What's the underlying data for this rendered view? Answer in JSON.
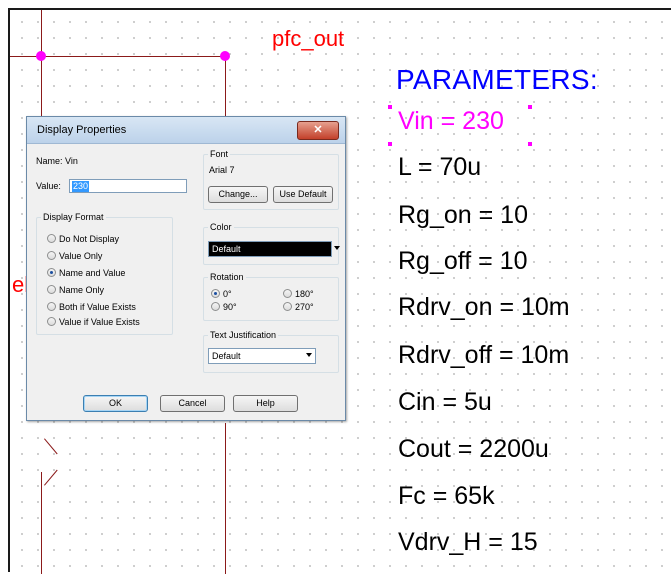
{
  "schematic": {
    "net_label": "pfc_out",
    "partial_label": "el",
    "parameters_title": "PARAMETERS:",
    "parameters": [
      {
        "text": "Vin = 230",
        "selected": true
      },
      {
        "text": "L = 70u"
      },
      {
        "text": "Rg_on = 10"
      },
      {
        "text": "Rg_off = 10"
      },
      {
        "text": "Rdrv_on = 10m"
      },
      {
        "text": "Rdrv_off = 10m"
      },
      {
        "text": "Cin = 5u"
      },
      {
        "text": "Cout = 2200u"
      },
      {
        "text": "Fc = 65k"
      },
      {
        "text": "Vdrv_H = 15"
      }
    ],
    "colors": {
      "wire": "#8b1a1a",
      "node": "#ff00ff",
      "net_label": "#ff0000",
      "title": "#0000ff",
      "selected": "#ff00ff"
    }
  },
  "dialog": {
    "title": "Display Properties",
    "close_glyph": "✕",
    "name_label": "Name:",
    "name_value": "Vin",
    "value_label": "Value:",
    "value_value": "230",
    "display_format": {
      "title": "Display Format",
      "options": [
        {
          "label": "Do Not Display",
          "selected": false
        },
        {
          "label": "Value Only",
          "selected": false
        },
        {
          "label": "Name and Value",
          "selected": true
        },
        {
          "label": "Name Only",
          "selected": false
        },
        {
          "label": "Both if Value Exists",
          "selected": false
        },
        {
          "label": "Value if Value Exists",
          "selected": false
        }
      ]
    },
    "font": {
      "title": "Font",
      "value": "Arial 7",
      "change_label": "Change...",
      "use_default_label": "Use Default"
    },
    "color": {
      "title": "Color",
      "selected": "Default"
    },
    "rotation": {
      "title": "Rotation",
      "options": [
        {
          "label": "0°",
          "selected": true
        },
        {
          "label": "180°",
          "selected": false
        },
        {
          "label": "90°",
          "selected": false
        },
        {
          "label": "270°",
          "selected": false
        }
      ]
    },
    "text_justification": {
      "title": "Text Justification",
      "selected": "Default"
    },
    "buttons": {
      "ok": "OK",
      "cancel": "Cancel",
      "help": "Help"
    }
  }
}
